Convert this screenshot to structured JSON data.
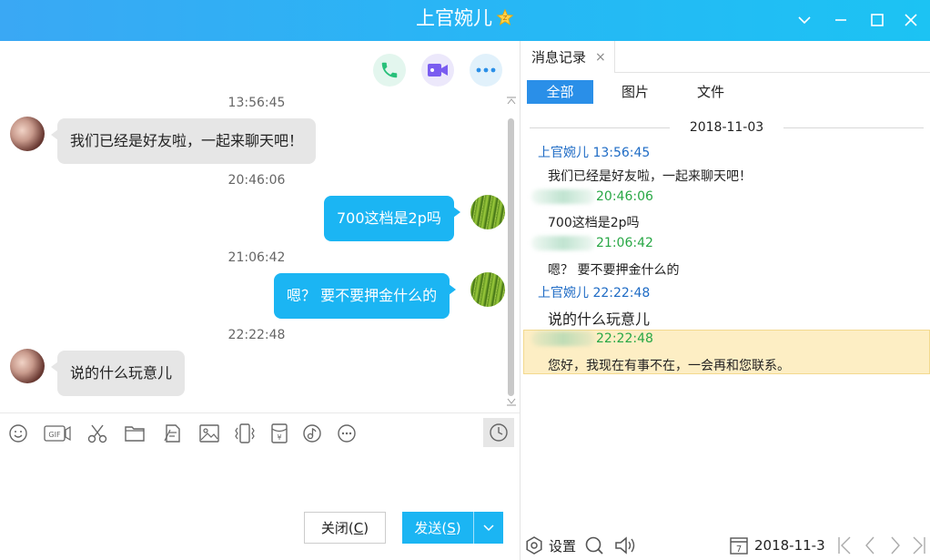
{
  "window": {
    "title": "上官婉儿",
    "controls": [
      "chevron-down-icon",
      "minimize-icon",
      "maximize-icon",
      "close-icon"
    ]
  },
  "chat": {
    "actions": [
      "phone-icon",
      "video-icon",
      "more-icon"
    ],
    "messages": [
      {
        "time": "13:56:45",
        "direction": "in",
        "text": "我们已经是好友啦，一起来聊天吧！"
      },
      {
        "time": "20:46:06",
        "direction": "out",
        "text": "700这档是2p吗"
      },
      {
        "time": "21:06:42",
        "direction": "out",
        "text": "嗯？ 要不要押金什么的"
      },
      {
        "time": "22:22:48",
        "direction": "in",
        "text": "说的什么玩意儿"
      }
    ],
    "toolbar": [
      "emoji-icon",
      "gif-icon",
      "scissors-icon",
      "folder-icon",
      "doc-icon",
      "image-icon",
      "shake-icon",
      "redpacket-icon",
      "music-icon",
      "more-icon",
      "clock-icon"
    ],
    "close_label": "关闭(",
    "close_key": "C",
    "close_end": ")",
    "send_label": "发送(",
    "send_key": "S",
    "send_end": ")"
  },
  "history": {
    "tab_label": "消息记录",
    "tab_close": "×",
    "filters": [
      "全部",
      "图片",
      "文件"
    ],
    "date": "2018-11-03",
    "entries": [
      {
        "sender": "上官婉儿",
        "time": "13:56:45",
        "text": "我们已经是好友啦，一起来聊天吧！"
      },
      {
        "sender": "",
        "time": "20:46:06",
        "text": "700这档是2p吗"
      },
      {
        "sender": "",
        "time": "21:06:42",
        "text": "嗯？ 要不要押金什么的"
      },
      {
        "sender": "上官婉儿",
        "time": "22:22:48",
        "text": "说的什么玩意儿"
      },
      {
        "sender": "",
        "time": "22:22:48",
        "text": "您好，我现在有事不在，一会再和您联系。"
      }
    ],
    "footer": {
      "settings_label": "设置",
      "date_value": "2018-11-3",
      "calendar_day": "7"
    }
  },
  "colors": {
    "accent": "#1bb5f3",
    "history_tab_active": "#2a8fe8",
    "peer_name": "#1e6bc5",
    "self_name": "#28a745",
    "highlight": "#fdeec4"
  }
}
